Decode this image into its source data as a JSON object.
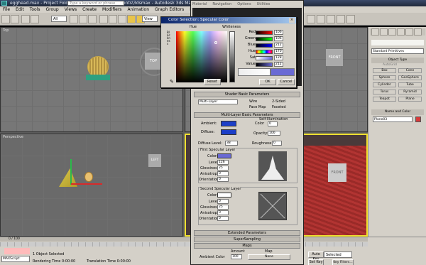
{
  "titlebar": {
    "file": "egghead.max",
    "title": " - Project Folder: C:\\Users\\Iweth\\Documents\\3dsmax    - Autodesk 3ds Max 2009       - Display : Direct 3D",
    "search_placeholder": "Type a keyword or phrase"
  },
  "menu": [
    "File",
    "Edit",
    "Tools",
    "Group",
    "Views",
    "Create",
    "Modifiers",
    "Animation",
    "Graph Editors",
    "Rendering",
    "Customize",
    "MAXScript"
  ],
  "toolbar": {
    "selection_filter": "All",
    "view": "View"
  },
  "viewports": {
    "top": {
      "label": "Top"
    },
    "front": {
      "label": "Front",
      "cube_label": "FRONT"
    },
    "perspective": {
      "label": "Perspective",
      "cube_label": "LEFT"
    },
    "cube_top": "TOP",
    "cube_front2": "FRONT"
  },
  "color_dialog": {
    "title": "Color Selection: Specular Color",
    "hue": "Hue",
    "whiteness": "Whiteness",
    "blackness": "Blackness",
    "channels": [
      {
        "label": "Red",
        "value": "106"
      },
      {
        "label": "Green",
        "value": "106"
      },
      {
        "label": "Blue",
        "value": "212"
      },
      {
        "label": "Hue",
        "value": "170"
      },
      {
        "label": "Sat",
        "value": "128"
      },
      {
        "label": "Value",
        "value": "212"
      }
    ],
    "reset": "Reset",
    "ok": "OK",
    "cancel": "Cancel"
  },
  "mat_editor": {
    "tabs": [
      "Material",
      "Navigation",
      "Options",
      "Utilities"
    ],
    "shader_rollout": "Shader Basic Parameters",
    "shader": "Multi-Layer",
    "wire": "Wire",
    "two_sided": "2-Sided",
    "face_map": "Face Map",
    "faceted": "Faceted",
    "basic_rollout": "Multi-Layer Basic Parameters",
    "self_illum": "Self-Illumination",
    "color": "Color",
    "color_val": "0",
    "ambient": "Ambient:",
    "diffuse": "Diffuse:",
    "opacity": "Opacity:",
    "opacity_val": "100",
    "diffuse_level": "Diffuse Level:",
    "diffuse_level_val": "38",
    "roughness": "Roughness:",
    "roughness_val": "0",
    "first_layer": "First Specular Layer",
    "second_layer": "Second Specular Layer",
    "layer_color": "Color:",
    "level": "Level:",
    "level1_val": "126",
    "level2_val": "0",
    "glossiness": "Glossiness:",
    "gloss1_val": "25",
    "gloss2_val": "25",
    "anisotropy": "Anisotropy:",
    "aniso1_val": "0",
    "aniso2_val": "0",
    "orientation": "Orientation:",
    "orient1_val": "0",
    "orient2_val": "0",
    "extended": "Extended Parameters",
    "supersampling": "SuperSampling",
    "maps": "Maps",
    "amount": "Amount",
    "map": "Map",
    "ambient_color": "Ambient Color",
    "ambient_amount": "100",
    "none": "None"
  },
  "cmd_panel": {
    "dropdown": "Standard Primitives",
    "object_type": "Object Type",
    "autogrid": "AutoGrid",
    "buttons": [
      "Box",
      "Cone",
      "Sphere",
      "GeoSphere",
      "Cylinder",
      "Tube",
      "Torus",
      "Pyramid",
      "Teapot",
      "Plane"
    ],
    "name_color": "Name and Color",
    "object_name": "Plane03"
  },
  "status": {
    "timeline": "0 / 100",
    "selected": "1 Object Selected",
    "rendering": "Rendering Time  0:00:00",
    "translation": "Translation Time  0:00:00",
    "maxscript": "MAXScript:",
    "autokey": "Auto Key",
    "selected_drop": "Selected",
    "setkey": "Set Key",
    "keyfilters": "Key Filters..."
  },
  "colors": {
    "specular": "#6a6ad4",
    "diffuse": "#1c3fc8"
  }
}
